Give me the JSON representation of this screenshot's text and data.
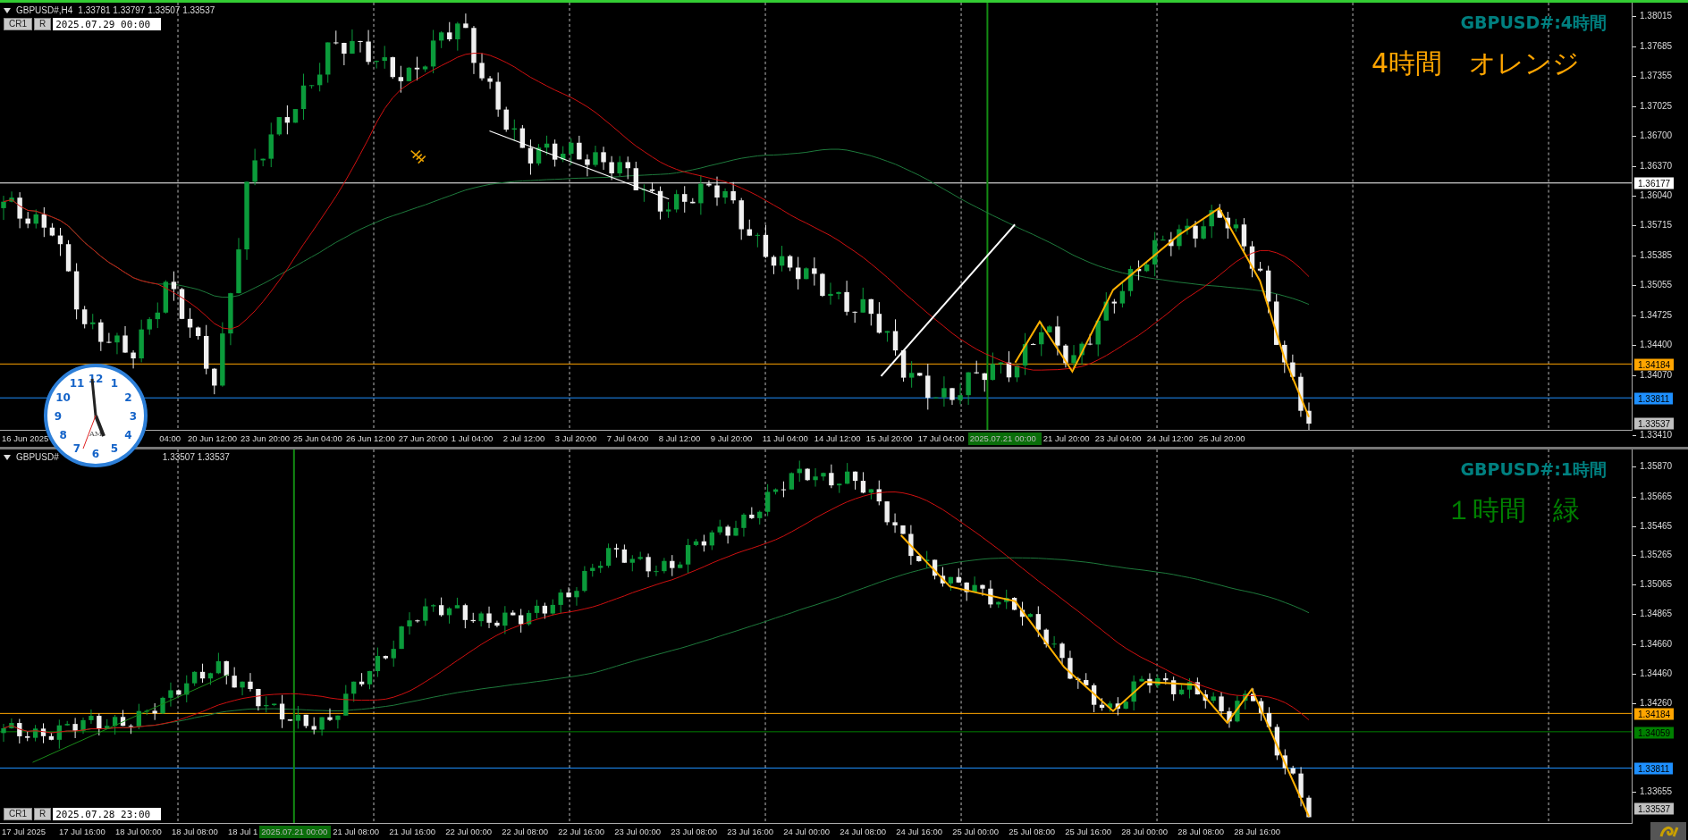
{
  "panes": [
    {
      "kind": "h4",
      "active": true,
      "header": {
        "symbol": "GBPUSD#,H4",
        "quotes": "1.33781 1.33797 1.33507 1.33537"
      },
      "buttons": [
        "CR1",
        "R"
      ],
      "time_field": "2025.07.29 00:00",
      "title": "GBPUSD#:4時間",
      "note": {
        "text": "4時間　オレンジ",
        "color": "#ffa500"
      },
      "price_labels": [
        "1.38015",
        "1.37685",
        "1.37355",
        "1.37025",
        "1.36700",
        "1.36370",
        "1.36040",
        "1.35715",
        "1.35385",
        "1.35055",
        "1.34725",
        "1.34400",
        "1.34070",
        "1.33410"
      ],
      "price_tags": [
        {
          "value": "1.36177",
          "color": "#ffffff",
          "kind": "level"
        },
        {
          "value": "1.34184",
          "color": "#ffa500",
          "kind": "level"
        },
        {
          "value": "1.33811",
          "color": "#1e90ff",
          "kind": "level"
        },
        {
          "value": "1.33537",
          "color": "#c0c0c0",
          "kind": "price"
        }
      ],
      "time_labels": [
        {
          "text": "16 Jun 2025",
          "highlighted": false
        },
        {
          "text": "04:00",
          "highlighted": false
        },
        {
          "text": "20 Jun 12:00",
          "highlighted": false
        },
        {
          "text": "23 Jun 20:00",
          "highlighted": false
        },
        {
          "text": "25 Jun 04:00",
          "highlighted": false
        },
        {
          "text": "26 Jun 12:00",
          "highlighted": false
        },
        {
          "text": "27 Jun 20:00",
          "highlighted": false
        },
        {
          "text": "1 Jul 04:00",
          "highlighted": false
        },
        {
          "text": "2 Jul 12:00",
          "highlighted": false
        },
        {
          "text": "3 Jul 20:00",
          "highlighted": false
        },
        {
          "text": "7 Jul 04:00",
          "highlighted": false
        },
        {
          "text": "8 Jul 12:00",
          "highlighted": false
        },
        {
          "text": "9 Jul 20:00",
          "highlighted": false
        },
        {
          "text": "11 Jul 04:00",
          "highlighted": false
        },
        {
          "text": "14 Jul 12:00",
          "highlighted": false
        },
        {
          "text": "15 Jul 20:00",
          "highlighted": false
        },
        {
          "text": "17 Jul 04:00",
          "highlighted": false
        },
        {
          "text": "2025.07.21 00:00",
          "highlighted": true
        },
        {
          "text": "21 Jul 20:00",
          "highlighted": false
        },
        {
          "text": "23 Jul 04:00",
          "highlighted": false
        },
        {
          "text": "24 Jul 12:00",
          "highlighted": false
        },
        {
          "text": "25 Jul 20:00",
          "highlighted": false
        }
      ]
    },
    {
      "kind": "h1",
      "active": false,
      "header": {
        "symbol": "GBPUSD#",
        "quotes": "1.33507 1.33537"
      },
      "buttons": [
        "CR1",
        "R"
      ],
      "time_field": "2025.07.28 23:00",
      "title": "GBPUSD#:1時間",
      "note": {
        "text": "１時間　緑",
        "color": "#008000"
      },
      "price_labels": [
        "1.35870",
        "1.35665",
        "1.35465",
        "1.35265",
        "1.35065",
        "1.34865",
        "1.34660",
        "1.34460",
        "1.34260",
        "1.33655"
      ],
      "price_tags": [
        {
          "value": "1.34184",
          "color": "#ffa500",
          "kind": "level"
        },
        {
          "value": "1.34059",
          "color": "#008000",
          "kind": "level"
        },
        {
          "value": "1.33811",
          "color": "#1e90ff",
          "kind": "level"
        },
        {
          "value": "1.33537",
          "color": "#c0c0c0",
          "kind": "price"
        }
      ],
      "time_labels": [
        {
          "text": "17 Jul 2025",
          "highlighted": false
        },
        {
          "text": "17 Jul 16:00",
          "highlighted": false
        },
        {
          "text": "18 Jul 00:00",
          "highlighted": false
        },
        {
          "text": "18 Jul 08:00",
          "highlighted": false
        },
        {
          "text": "18 Jul 1",
          "highlighted": false
        },
        {
          "text": "2025.07.21 00:00",
          "highlighted": true
        },
        {
          "text": "21 Jul 08:00",
          "highlighted": false
        },
        {
          "text": "21 Jul 16:00",
          "highlighted": false
        },
        {
          "text": "22 Jul 00:00",
          "highlighted": false
        },
        {
          "text": "22 Jul 08:00",
          "highlighted": false
        },
        {
          "text": "22 Jul 16:00",
          "highlighted": false
        },
        {
          "text": "23 Jul 00:00",
          "highlighted": false
        },
        {
          "text": "23 Jul 08:00",
          "highlighted": false
        },
        {
          "text": "23 Jul 16:00",
          "highlighted": false
        },
        {
          "text": "24 Jul 00:00",
          "highlighted": false
        },
        {
          "text": "24 Jul 08:00",
          "highlighted": false
        },
        {
          "text": "24 Jul 16:00",
          "highlighted": false
        },
        {
          "text": "25 Jul 00:00",
          "highlighted": false
        },
        {
          "text": "25 Jul 08:00",
          "highlighted": false
        },
        {
          "text": "25 Jul 16:00",
          "highlighted": false
        },
        {
          "text": "28 Jul 00:00",
          "highlighted": false
        },
        {
          "text": "28 Jul 08:00",
          "highlighted": false
        },
        {
          "text": "28 Jul 16:00",
          "highlighted": false
        }
      ]
    }
  ],
  "clock": {
    "numerals": [
      "11",
      "12",
      "1",
      "10",
      "2",
      "9",
      "3",
      "8",
      "4",
      "7",
      "6",
      "5"
    ],
    "label": "AM"
  }
}
